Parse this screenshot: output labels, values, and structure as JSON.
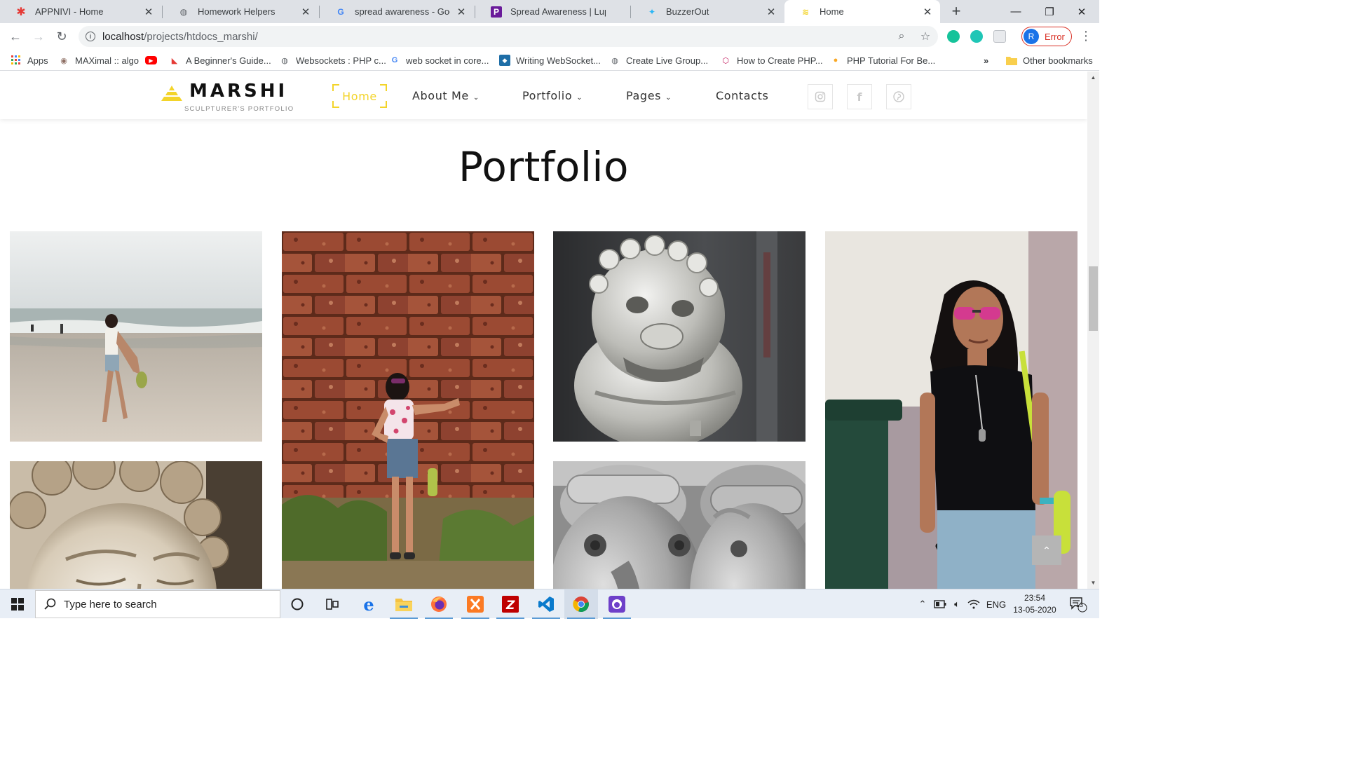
{
  "browser": {
    "tabs": [
      {
        "title": "APPNIVI - Home",
        "icon": "asterisk-icon",
        "color": "#e53935"
      },
      {
        "title": "Homework Helpers",
        "icon": "globe-icon",
        "color": "#5f6368"
      },
      {
        "title": "spread awareness - Google S",
        "icon": "google-icon",
        "color": "#4285f4"
      },
      {
        "title": "Spread Awareness | Lupus Fo",
        "icon": "p-icon",
        "color": "#6a1b9a"
      },
      {
        "title": "BuzzerOut",
        "icon": "bird-icon",
        "color": "#29b6f6"
      },
      {
        "title": "Home",
        "icon": "bars-icon",
        "color": "#f3d42a"
      }
    ],
    "active_tab": 5,
    "url_host": "localhost",
    "url_path": "/projects/htdocs_marshi/",
    "profile_initial": "R",
    "profile_label": "Error",
    "bookmarks": [
      {
        "label": "Apps",
        "icon": "apps-grid-icon"
      },
      {
        "label": "MAXimal :: algo",
        "icon": "owl-icon"
      },
      {
        "label": "",
        "icon": "youtube-icon"
      },
      {
        "label": "A Beginner's Guide...",
        "icon": "red-triangle-icon"
      },
      {
        "label": "Websockets : PHP c...",
        "icon": "globe-icon"
      },
      {
        "label": "web socket in core...",
        "icon": "google-icon"
      },
      {
        "label": "Writing WebSocket...",
        "icon": "mdn-icon"
      },
      {
        "label": "Create Live Group...",
        "icon": "globe-icon"
      },
      {
        "label": "How to Create PHP...",
        "icon": "cube-icon"
      },
      {
        "label": "PHP Tutorial For Be...",
        "icon": "orange-dot-icon"
      }
    ],
    "more_bookmarks": "»",
    "other_bookmarks": "Other bookmarks"
  },
  "site": {
    "logo_name": "MARSHI",
    "logo_tagline": "SCULPTURER'S PORTFOLIO",
    "nav": [
      {
        "label": "Home",
        "active": true,
        "dropdown": false
      },
      {
        "label": "About Me",
        "active": false,
        "dropdown": true
      },
      {
        "label": "Portfolio",
        "active": false,
        "dropdown": true
      },
      {
        "label": "Pages",
        "active": false,
        "dropdown": true
      },
      {
        "label": "Contacts",
        "active": false,
        "dropdown": false
      }
    ],
    "social": [
      "instagram-icon",
      "facebook-icon",
      "pinterest-icon"
    ],
    "accent": "#f3d42a",
    "section_title": "Portfolio"
  },
  "portfolio": [
    {
      "name": "portfolio-item-beach",
      "subject": "woman walking on beach"
    },
    {
      "name": "portfolio-item-brick-wall",
      "subject": "woman by laterite brick wall"
    },
    {
      "name": "portfolio-item-lion-statue",
      "subject": "stone guardian lion sculpture"
    },
    {
      "name": "portfolio-item-woman-sunglasses",
      "subject": "woman with sunglasses"
    },
    {
      "name": "portfolio-item-marble-head",
      "subject": "marble head sculpture"
    },
    {
      "name": "portfolio-item-elephant-statue",
      "subject": "stone elephant sculpture"
    }
  ],
  "taskbar": {
    "search_placeholder": "Type here to search",
    "apps": [
      "cortana-icon",
      "task-view-icon",
      "edge-icon",
      "file-explorer-icon",
      "firefox-icon",
      "xampp-icon",
      "filezilla-icon",
      "vscode-icon",
      "chrome-icon",
      "github-desktop-icon"
    ],
    "language": "ENG",
    "time": "23:54",
    "date": "13-05-2020",
    "notifications": "13"
  }
}
